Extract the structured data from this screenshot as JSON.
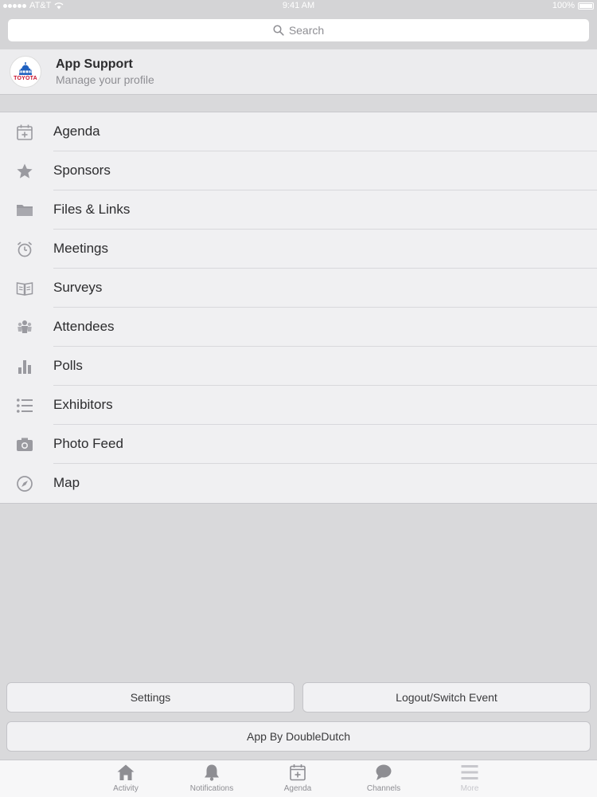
{
  "status_bar": {
    "carrier": "AT&T",
    "time": "9:41 AM",
    "battery": "100%"
  },
  "search": {
    "placeholder": "Search"
  },
  "profile": {
    "name": "App Support",
    "subtitle": "Manage your profile",
    "avatar_brand": "TOYOTA"
  },
  "menu": {
    "items": [
      {
        "label": "Agenda",
        "icon": "calendar-plus-icon"
      },
      {
        "label": "Sponsors",
        "icon": "star-icon"
      },
      {
        "label": "Files & Links",
        "icon": "folder-icon"
      },
      {
        "label": "Meetings",
        "icon": "alarm-clock-icon"
      },
      {
        "label": "Surveys",
        "icon": "open-book-icon"
      },
      {
        "label": "Attendees",
        "icon": "people-icon"
      },
      {
        "label": "Polls",
        "icon": "bar-chart-icon"
      },
      {
        "label": "Exhibitors",
        "icon": "list-icon"
      },
      {
        "label": "Photo Feed",
        "icon": "camera-icon"
      },
      {
        "label": "Map",
        "icon": "compass-icon"
      }
    ]
  },
  "buttons": {
    "settings": "Settings",
    "logout": "Logout/Switch Event",
    "app_by": "App By DoubleDutch"
  },
  "tabbar": {
    "tabs": [
      {
        "label": "Activity",
        "icon": "home-icon"
      },
      {
        "label": "Notifications",
        "icon": "bell-icon"
      },
      {
        "label": "Agenda",
        "icon": "calendar-plus-icon"
      },
      {
        "label": "Channels",
        "icon": "chat-bubble-icon"
      },
      {
        "label": "More",
        "icon": "menu-lines-icon"
      }
    ]
  },
  "colors": {
    "background": "#d9d9db",
    "row_bg": "#f0f0f2",
    "icon_gray": "#9a9aa0",
    "text": "#2c2c2e",
    "brand_red": "#c8102e",
    "brand_blue": "#1d5fbf"
  }
}
